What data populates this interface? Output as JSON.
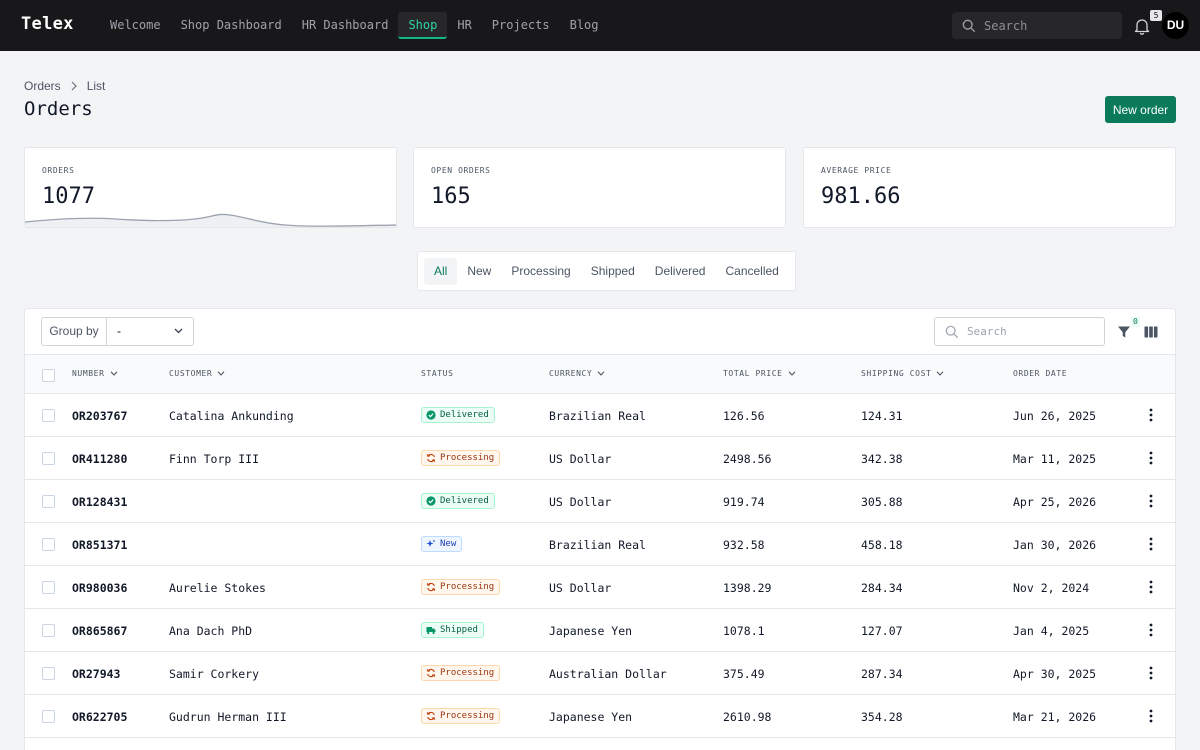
{
  "topbar": {
    "brand": "Telex",
    "nav": [
      {
        "label": "Welcome",
        "active": false
      },
      {
        "label": "Shop Dashboard",
        "active": false
      },
      {
        "label": "HR Dashboard",
        "active": false
      },
      {
        "label": "Shop",
        "active": true
      },
      {
        "label": "HR",
        "active": false
      },
      {
        "label": "Projects",
        "active": false
      },
      {
        "label": "Blog",
        "active": false
      }
    ],
    "search_placeholder": "Search",
    "notifications_count": "5",
    "avatar_initials": "DU"
  },
  "breadcrumb": [
    "Orders",
    "List"
  ],
  "page_title": "Orders",
  "new_order_label": "New order",
  "stats": [
    {
      "label": "ORDERS",
      "value": "1077"
    },
    {
      "label": "OPEN ORDERS",
      "value": "165"
    },
    {
      "label": "AVERAGE PRICE",
      "value": "981.66"
    }
  ],
  "tabs": [
    {
      "label": "All",
      "active": true
    },
    {
      "label": "New",
      "active": false
    },
    {
      "label": "Processing",
      "active": false
    },
    {
      "label": "Shipped",
      "active": false
    },
    {
      "label": "Delivered",
      "active": false
    },
    {
      "label": "Cancelled",
      "active": false
    }
  ],
  "toolbar": {
    "group_by_label": "Group by",
    "group_by_value": "-",
    "search_placeholder": "Search",
    "filter_count": "0"
  },
  "table": {
    "columns": [
      "NUMBER",
      "CUSTOMER",
      "STATUS",
      "CURRENCY",
      "TOTAL PRICE",
      "SHIPPING COST",
      "ORDER DATE"
    ],
    "rows": [
      {
        "number": "OR203767",
        "customer": "Catalina Ankunding",
        "status": "Delivered",
        "currency": "Brazilian Real",
        "total": "126.56",
        "shipping": "124.31",
        "date": "Jun 26, 2025"
      },
      {
        "number": "OR411280",
        "customer": "Finn Torp III",
        "status": "Processing",
        "currency": "US Dollar",
        "total": "2498.56",
        "shipping": "342.38",
        "date": "Mar 11, 2025"
      },
      {
        "number": "OR128431",
        "customer": "",
        "status": "Delivered",
        "currency": "US Dollar",
        "total": "919.74",
        "shipping": "305.88",
        "date": "Apr 25, 2026"
      },
      {
        "number": "OR851371",
        "customer": "",
        "status": "New",
        "currency": "Brazilian Real",
        "total": "932.58",
        "shipping": "458.18",
        "date": "Jan 30, 2026"
      },
      {
        "number": "OR980036",
        "customer": "Aurelie Stokes",
        "status": "Processing",
        "currency": "US Dollar",
        "total": "1398.29",
        "shipping": "284.34",
        "date": "Nov 2, 2024"
      },
      {
        "number": "OR865867",
        "customer": "Ana Dach PhD",
        "status": "Shipped",
        "currency": "Japanese Yen",
        "total": "1078.1",
        "shipping": "127.07",
        "date": "Jan 4, 2025"
      },
      {
        "number": "OR27943",
        "customer": "Samir Corkery",
        "status": "Processing",
        "currency": "Australian Dollar",
        "total": "375.49",
        "shipping": "287.34",
        "date": "Apr 30, 2025"
      },
      {
        "number": "OR622705",
        "customer": "Gudrun Herman III",
        "status": "Processing",
        "currency": "Japanese Yen",
        "total": "2610.98",
        "shipping": "354.28",
        "date": "Mar 21, 2026"
      }
    ]
  }
}
